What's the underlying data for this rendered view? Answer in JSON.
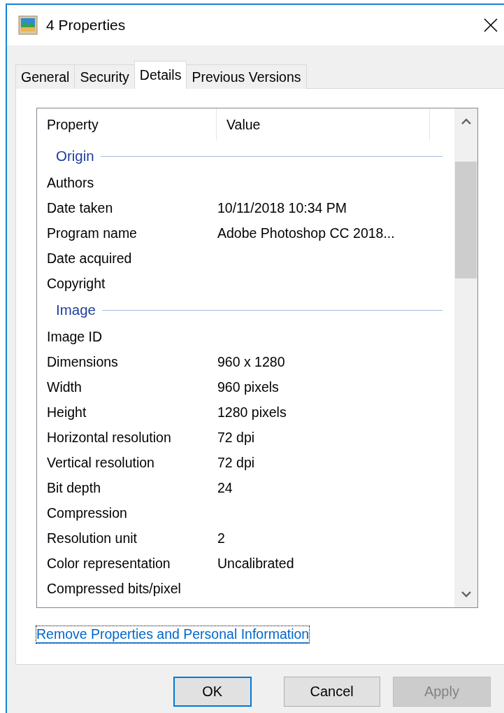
{
  "window": {
    "title": "4 Properties"
  },
  "tabs": [
    {
      "label": "General",
      "selected": false
    },
    {
      "label": "Security",
      "selected": false
    },
    {
      "label": "Details",
      "selected": true
    },
    {
      "label": "Previous Versions",
      "selected": false
    }
  ],
  "table": {
    "columns": [
      "Property",
      "Value"
    ],
    "rows": [
      {
        "kind": "group",
        "name": "Origin"
      },
      {
        "kind": "property",
        "name": "Authors"
      },
      {
        "kind": "property",
        "name": "Date taken",
        "value": "10/11/2018 10:34 PM"
      },
      {
        "kind": "property",
        "name": "Program name",
        "value": "Adobe Photoshop CC 2018..."
      },
      {
        "kind": "property",
        "name": "Date acquired"
      },
      {
        "kind": "property",
        "name": "Copyright"
      },
      {
        "kind": "group",
        "name": "Image"
      },
      {
        "kind": "property",
        "name": "Image ID"
      },
      {
        "kind": "property",
        "name": "Dimensions",
        "value": "960 x 1280"
      },
      {
        "kind": "property",
        "name": "Width",
        "value": "960 pixels"
      },
      {
        "kind": "property",
        "name": "Height",
        "value": "1280 pixels"
      },
      {
        "kind": "property",
        "name": "Horizontal resolution",
        "value": "72 dpi"
      },
      {
        "kind": "property",
        "name": "Vertical resolution",
        "value": "72 dpi"
      },
      {
        "kind": "property",
        "name": "Bit depth",
        "value": "24"
      },
      {
        "kind": "property",
        "name": "Compression"
      },
      {
        "kind": "property",
        "name": "Resolution unit",
        "value": "2"
      },
      {
        "kind": "property",
        "name": "Color representation",
        "value": "Uncalibrated"
      },
      {
        "kind": "property",
        "name": "Compressed bits/pixel"
      }
    ]
  },
  "link": "Remove Properties and Personal Information",
  "buttons": [
    {
      "label": "OK",
      "default": true,
      "disabled": false
    },
    {
      "label": "Cancel",
      "default": false,
      "disabled": false
    },
    {
      "label": "Apply",
      "default": false,
      "disabled": true
    }
  ]
}
